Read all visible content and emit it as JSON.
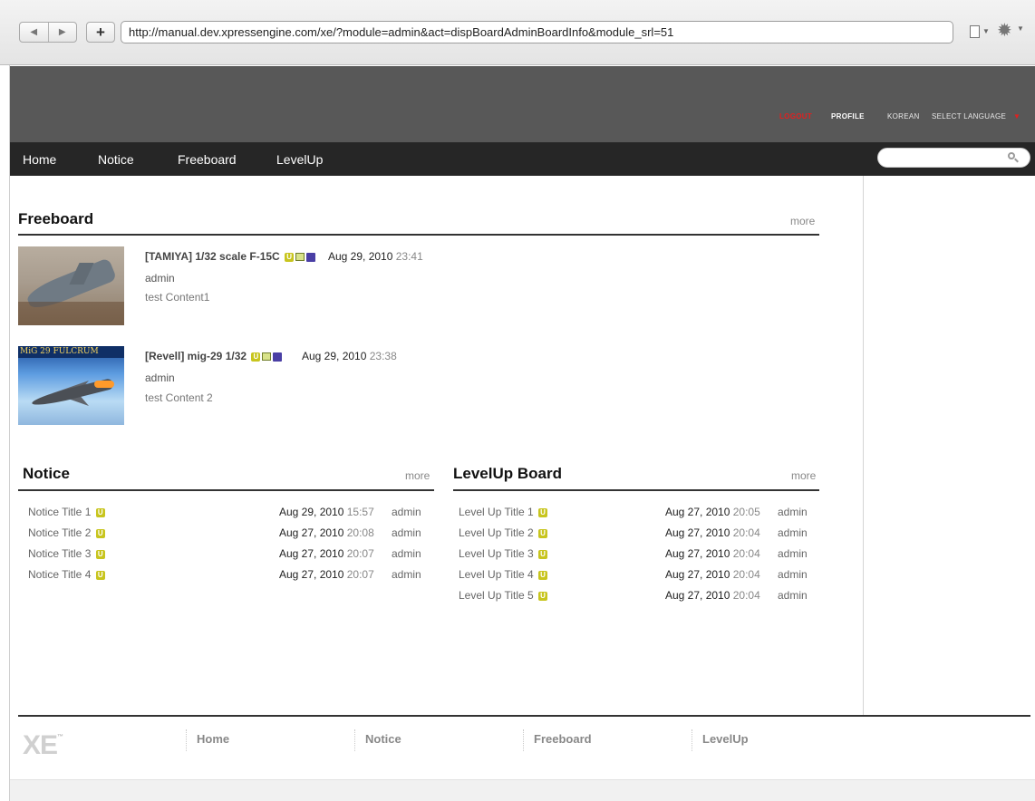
{
  "browser": {
    "back_glyph": "◀",
    "forward_glyph": "▶",
    "plus_glyph": "+",
    "url": "http://manual.dev.xpressengine.com/xe/?module=admin&act=dispBoardAdminBoardInfo&module_srl=51",
    "icons": [
      "back-icon",
      "forward-icon",
      "new-tab-icon",
      "page-icon",
      "gear-icon"
    ]
  },
  "header": {
    "logout": "LOGOUT",
    "profile": "PROFILE",
    "korean": "KOREAN",
    "select_language": "SELECT LANGUAGE",
    "accent_color": "#e02020",
    "background_color": "#585858"
  },
  "gnb": {
    "items": [
      "Home",
      "Notice",
      "Freeboard",
      "LevelUp"
    ],
    "background_color": "#262626"
  },
  "search": {
    "value": "",
    "placeholder": ""
  },
  "freeboard": {
    "title": "Freeboard",
    "more": "more",
    "posts": [
      {
        "title": "[TAMIYA] 1/32 scale F-15C",
        "date": "Aug 29, 2010",
        "time": "23:41",
        "author": "admin",
        "content": "test Content1",
        "badges": [
          "new-icon",
          "image-icon",
          "file-icon"
        ]
      },
      {
        "title": "[Revell] mig-29 1/32",
        "date": "Aug 29, 2010",
        "time": "23:38",
        "author": "admin",
        "content": "test Content 2",
        "thumb_banner": "MiG 29 FULCRUM",
        "badges": [
          "new-icon",
          "image-icon",
          "file-icon"
        ]
      }
    ]
  },
  "notice": {
    "title": "Notice",
    "more": "more",
    "items": [
      {
        "title": "Notice Title 1",
        "date": "Aug 29, 2010",
        "time": "15:57",
        "author": "admin"
      },
      {
        "title": "Notice Title 2",
        "date": "Aug 27, 2010",
        "time": "20:08",
        "author": "admin"
      },
      {
        "title": "Notice Title 3",
        "date": "Aug 27, 2010",
        "time": "20:07",
        "author": "admin"
      },
      {
        "title": "Notice Title 4",
        "date": "Aug 27, 2010",
        "time": "20:07",
        "author": "admin"
      }
    ]
  },
  "levelup": {
    "title": "LevelUp Board",
    "more": "more",
    "items": [
      {
        "title": "Level Up Title 1",
        "date": "Aug 27, 2010",
        "time": "20:05",
        "author": "admin"
      },
      {
        "title": "Level Up Title 2",
        "date": "Aug 27, 2010",
        "time": "20:04",
        "author": "admin"
      },
      {
        "title": "Level Up Title 3",
        "date": "Aug 27, 2010",
        "time": "20:04",
        "author": "admin"
      },
      {
        "title": "Level Up Title 4",
        "date": "Aug 27, 2010",
        "time": "20:04",
        "author": "admin"
      },
      {
        "title": "Level Up Title 5",
        "date": "Aug 27, 2010",
        "time": "20:04",
        "author": "admin"
      }
    ]
  },
  "footer": {
    "logo": "XE",
    "logo_tm": "™",
    "links": [
      "Home",
      "Notice",
      "Freeboard",
      "LevelUp"
    ]
  }
}
